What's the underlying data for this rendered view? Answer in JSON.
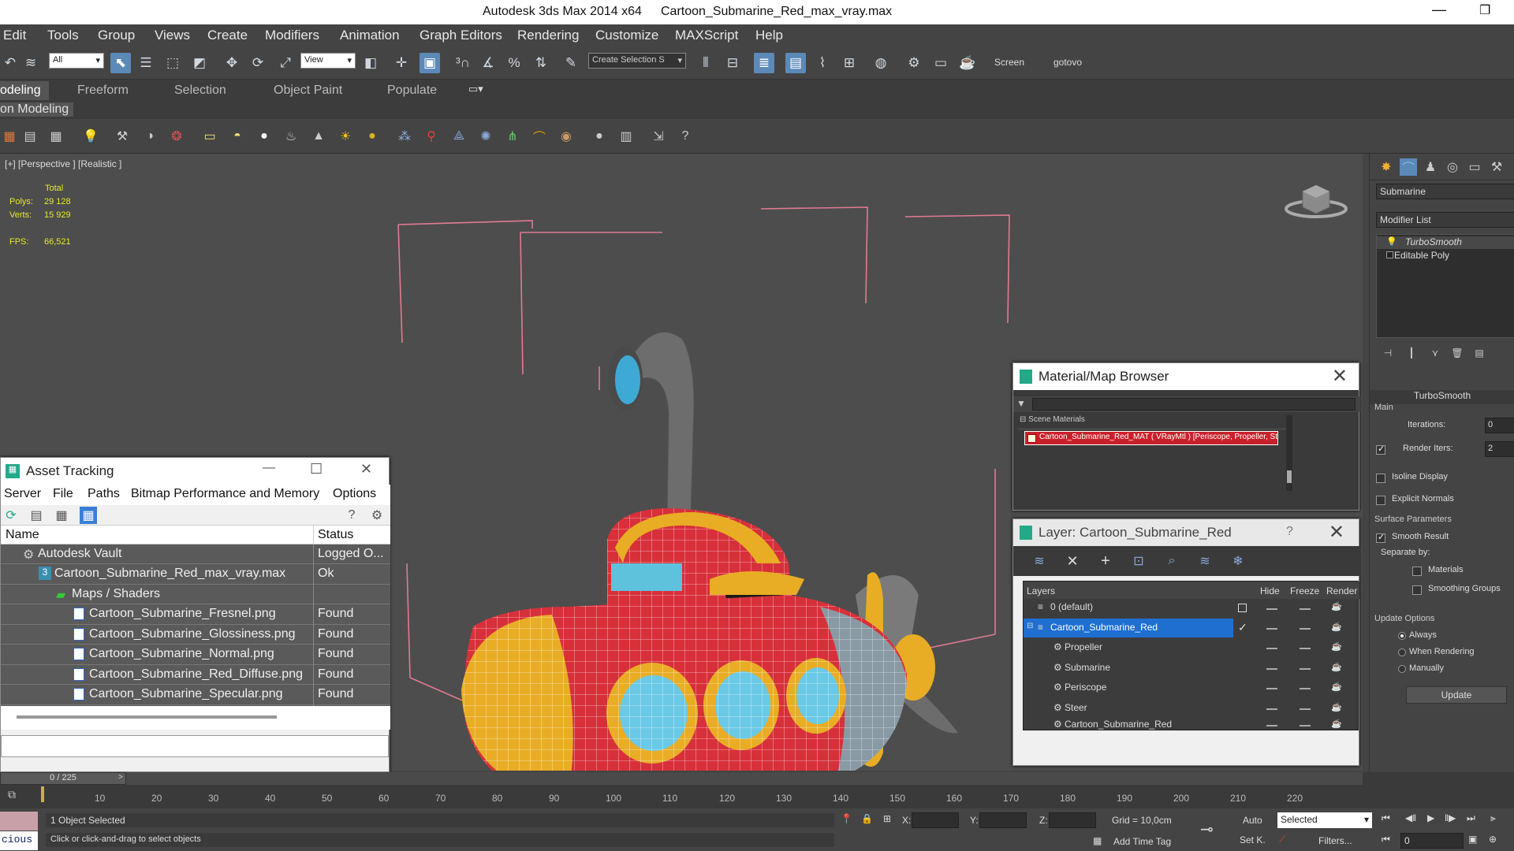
{
  "titlebar": {
    "app_title": "Autodesk 3ds Max  2014 x64",
    "file_title": "Cartoon_Submarine_Red_max_vray.max",
    "minimize": "—",
    "maximize": "❐"
  },
  "menu": [
    "Edit",
    "Tools",
    "Group",
    "Views",
    "Create",
    "Modifiers",
    "Animation",
    "Graph Editors",
    "Rendering",
    "Customize",
    "MAXScript",
    "Help"
  ],
  "toolbar": {
    "filter_value": "All",
    "refcoord_value": "View",
    "selection_set_placeholder": "Create Selection S",
    "screen_label": "Screen",
    "gotovo_label": "gotovo"
  },
  "ribbon_tabs": [
    "odeling",
    "Freeform",
    "Selection",
    "Object Paint",
    "Populate"
  ],
  "ribbon_panel_label": "on Modeling",
  "viewport": {
    "label": "[+] [Perspective ] [Realistic ]",
    "stats_total": "Total",
    "polys_label": "Polys:",
    "polys_value": "29 128",
    "verts_label": "Verts:",
    "verts_value": "15 929",
    "fps_label": "FPS:",
    "fps_value": "66,521"
  },
  "command_panel": {
    "object_name": "Submarine",
    "modifier_list": "Modifier List",
    "stack": [
      "TurboSmooth",
      "Editable Poly"
    ],
    "rollout_title": "TurboSmooth",
    "main_label": "Main",
    "iterations_label": "Iterations:",
    "iterations_value": "0",
    "render_iters_label": "Render Iters:",
    "render_iters_value": "2",
    "isoline_display": "Isoline Display",
    "explicit_normals": "Explicit Normals",
    "surface_params": "Surface Parameters",
    "smooth_result": "Smooth Result",
    "separate_by": "Separate by:",
    "materials": "Materials",
    "smoothing_groups": "Smoothing Groups",
    "update_options": "Update Options",
    "always": "Always",
    "when_rendering": "When Rendering",
    "manually": "Manually",
    "update_button": "Update"
  },
  "material_browser": {
    "title": "Material/Map Browser",
    "close": "✕",
    "group_label": "Scene Materials",
    "item": "Cartoon_Submarine_Red_MAT  ( VRayMtl ) [Periscope, Propeller, St..."
  },
  "layer_window": {
    "title": "Layer: Cartoon_Submarine_Red",
    "help": "?",
    "close": "✕",
    "columns": [
      "Layers",
      "Hide",
      "Freeze",
      "Render"
    ],
    "rows": [
      {
        "name": "0 (default)"
      },
      {
        "name": "Cartoon_Submarine_Red"
      },
      {
        "name": "Propeller"
      },
      {
        "name": "Submarine"
      },
      {
        "name": "Periscope"
      },
      {
        "name": "Steer"
      },
      {
        "name": "Cartoon_Submarine_Red"
      }
    ]
  },
  "asset_tracking": {
    "title": "Asset Tracking",
    "menu": [
      "Server",
      "File",
      "Paths",
      "Bitmap Performance and Memory",
      "Options"
    ],
    "col_name": "Name",
    "col_status": "Status",
    "rows": [
      {
        "name": "Autodesk Vault",
        "status": "Logged O..."
      },
      {
        "name": "Cartoon_Submarine_Red_max_vray.max",
        "status": "Ok"
      },
      {
        "name": "Maps / Shaders",
        "status": ""
      },
      {
        "name": "Cartoon_Submarine_Fresnel.png",
        "status": "Found"
      },
      {
        "name": "Cartoon_Submarine_Glossiness.png",
        "status": "Found"
      },
      {
        "name": "Cartoon_Submarine_Normal.png",
        "status": "Found"
      },
      {
        "name": "Cartoon_Submarine_Red_Diffuse.png",
        "status": "Found"
      },
      {
        "name": "Cartoon_Submarine_Specular.png",
        "status": "Found"
      }
    ],
    "minimize": "—",
    "maximize": "☐",
    "close": "✕"
  },
  "timeline": {
    "frame_counter": "0 / 225",
    "ticks": [
      "10",
      "20",
      "30",
      "40",
      "50",
      "60",
      "70",
      "80",
      "90",
      "100",
      "110",
      "120",
      "130",
      "140",
      "150",
      "160",
      "170",
      "180",
      "190",
      "200",
      "210",
      "220"
    ]
  },
  "status": {
    "selected": "1 Object Selected",
    "prompt": "Click or click-and-drag to select objects",
    "x_label": "X:",
    "y_label": "Y:",
    "z_label": "Z:",
    "grid": "Grid = 10,0cm",
    "add_time_tag": "Add Time Tag",
    "auto": "Auto",
    "set_k": "Set K.",
    "selected_dropdown": "Selected",
    "filters": "Filters...",
    "frame_value": "0",
    "maxscript_text": "cious"
  },
  "colors": {
    "accent": "#3a7fd5",
    "bbox": "#e07a93",
    "stats": "#e8e82a"
  }
}
